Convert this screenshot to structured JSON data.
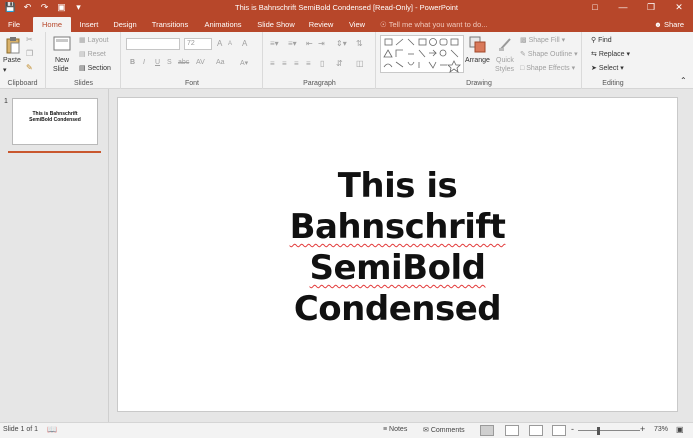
{
  "app": {
    "title": "This is Bahnschrift SemiBold Condensed [Read-Only] - PowerPoint",
    "accent": "#b7472a"
  },
  "qat": {
    "save_icon": "save-icon",
    "undo_icon": "undo-icon",
    "redo_icon": "redo-icon",
    "start_icon": "start-from-beginning-icon",
    "customize_icon": "customize-qat-icon"
  },
  "tabs": [
    {
      "label": "File"
    },
    {
      "label": "Home"
    },
    {
      "label": "Insert"
    },
    {
      "label": "Design"
    },
    {
      "label": "Transitions"
    },
    {
      "label": "Animations"
    },
    {
      "label": "Slide Show"
    },
    {
      "label": "Review"
    },
    {
      "label": "View"
    }
  ],
  "tellme": "Tell me what you want to do...",
  "share": "Share",
  "ribbon": {
    "clipboard": {
      "paste": "Paste",
      "label": "Clipboard"
    },
    "slides": {
      "new_slide": "New",
      "new_slide2": "Slide",
      "layout": "Layout",
      "reset": "Reset",
      "section": "Section",
      "label": "Slides"
    },
    "font": {
      "size_value": "72",
      "label": "Font",
      "bold": "B",
      "italic": "I",
      "underline": "U",
      "strike": "S",
      "shadow": "abc",
      "spacing": "AV",
      "case": "Aa",
      "grow": "A",
      "shrink": "A",
      "clear": "A"
    },
    "paragraph": {
      "label": "Paragraph"
    },
    "drawing": {
      "arrange": "Arrange",
      "quick_styles": "Quick",
      "quick_styles2": "Styles",
      "shape_fill": "Shape Fill",
      "shape_outline": "Shape Outline",
      "shape_effects": "Shape Effects",
      "label": "Drawing"
    },
    "editing": {
      "find": "Find",
      "replace": "Replace",
      "select": "Select",
      "label": "Editing"
    }
  },
  "thumbnails": [
    {
      "number": "1",
      "text_line1": "This is Bahnschrift",
      "text_line2": "SemiBold Condensed"
    }
  ],
  "slide": {
    "title_line1": "This is Bahnschrift",
    "title_line2_a": "SemiBold",
    "title_line2_b": "Condensed"
  },
  "status": {
    "slide_of": "Slide 1 of 1",
    "notes": "Notes",
    "comments": "Comments",
    "zoom": "73%",
    "minus": "-",
    "plus": "+"
  }
}
